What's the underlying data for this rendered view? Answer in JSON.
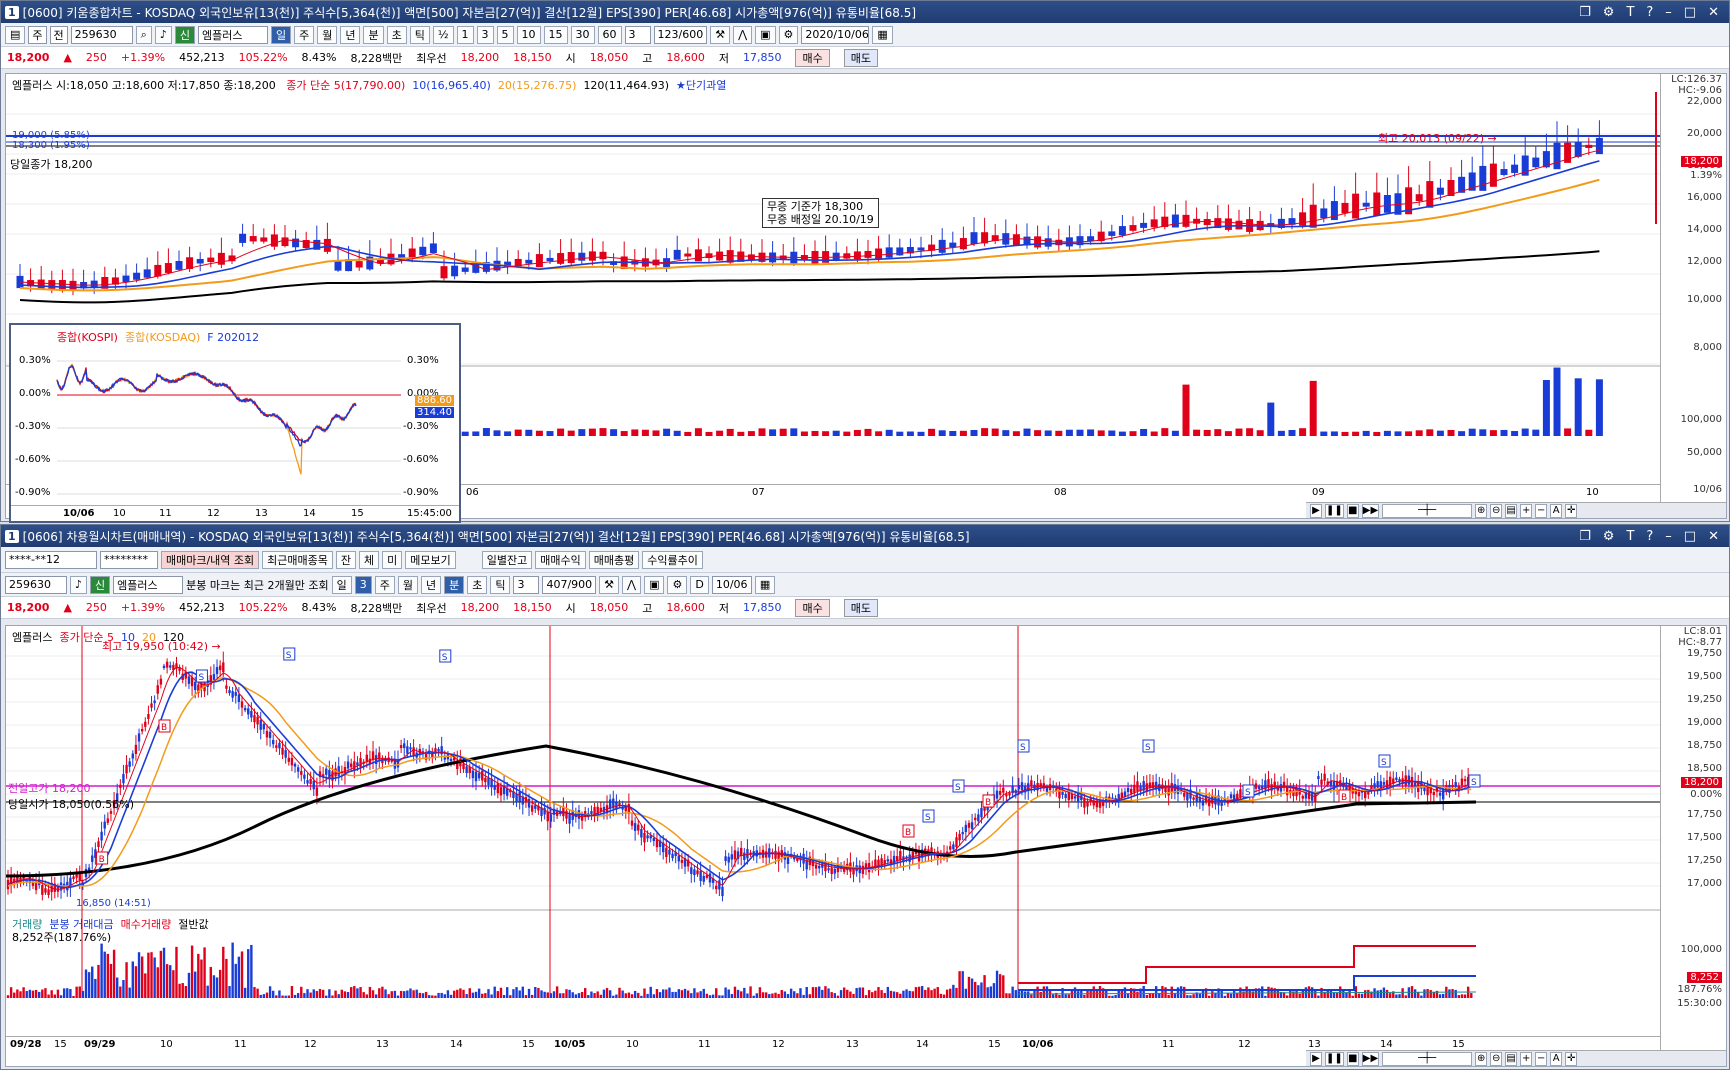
{
  "top": {
    "title": "[0600] 키움종합차트 - KOSDAQ 외국인보유[13(천)] 주식수[5,364(천)] 액면[500] 자본금[27(억)] 결산[12월] EPS[390] PER[46.68] 시가총액[976(억)] 유통비율[68.5]",
    "num": "1",
    "toolbar": {
      "type": "주",
      "combo": "전",
      "code": "259630",
      "tabs": [
        "일",
        "주",
        "월",
        "년",
        "분",
        "초",
        "틱"
      ],
      "active_tab": "일",
      "ints": [
        "½",
        "1",
        "3",
        "5",
        "10",
        "15",
        "30",
        "60"
      ],
      "count": "3",
      "ratio": "123/600",
      "date": "2020/10/06",
      "emplus": "엠플러스",
      "shin": "신"
    },
    "quote": {
      "price": "18,200",
      "arrow": "▲",
      "change": "250",
      "pct": "+1.39%",
      "volume": "452,213",
      "vol_ratio": "105.22%",
      "turnover": "8.43%",
      "amount": "8,228백만",
      "best_label": "최우선",
      "ask": "18,200",
      "bid": "18,150",
      "open_label": "시",
      "open": "18,050",
      "high_label": "고",
      "high": "18,600",
      "low_label": "저",
      "low": "17,850",
      "buy": "매수",
      "sell": "매도"
    },
    "legend": {
      "ohlc": "엠플러스 시:18,050 고:18,600 저:17,850 종:18,200",
      "ma_label": "종가 단순 5(17,790.00)",
      "ma10": "10(16,965.40)",
      "ma20": "20(15,276.75)",
      "ma120": "120(11,464.93)",
      "signal": "★단기과열"
    },
    "yaxis": [
      "22,000",
      "20,000",
      "18,000",
      "16,000",
      "14,000",
      "12,000",
      "10,000",
      "8,000"
    ],
    "lc": "LC:126.37",
    "hc": "HC:-9.06",
    "price_tag": "18,200",
    "price_pct": "1.39%",
    "hl1": "19,000 (5.85%)",
    "hl2": "18,300 (1.95%)",
    "prev_close": "당일종가 18,200",
    "peak_label": "최고 20,013 (09/22) →",
    "dividend": [
      "무증 기준가 18,300",
      "무증 배정일 20.10/19"
    ],
    "vol_axis": [
      "100,000",
      "50,000"
    ],
    "xaxis": [
      "06",
      "07",
      "08",
      "09",
      "10"
    ],
    "x_right": "10/06",
    "inset": {
      "legend": [
        "종합(KOSPI)",
        "종합(KOSDAQ)",
        "F 202012"
      ],
      "left_ticks": [
        "0.30%",
        "0.00%",
        "-0.30%",
        "-0.60%",
        "-0.90%"
      ],
      "right_ticks": [
        "0.30%",
        "0.00%",
        "-0.30%",
        "-0.60%",
        "-0.90%"
      ],
      "tag1": "886.60",
      "tag2": "314.40",
      "x": [
        "10/06",
        "10",
        "11",
        "12",
        "13",
        "14",
        "15"
      ],
      "time": "15:45:00"
    }
  },
  "bottom": {
    "title": "[0606] 차용월시차트(매매내역) - KOSDAQ 외국인보유[13(천)] 주식수[5,364(천)] 액면[500] 자본금[27(억)] 결산[12월] EPS[390] PER[46.68] 시가총액[976(억)] 유통비율[68.5]",
    "num": "1",
    "row1": {
      "account": "****-**12",
      "pw": "********",
      "btns": [
        "매매마크/내역 조회",
        "최근매매종목",
        "잔",
        "체",
        "미",
        "메모보기",
        "일별잔고",
        "매매수익",
        "매매총평",
        "수익률추이"
      ]
    },
    "row2": {
      "code": "259630",
      "emplus": "엠플러스",
      "shin": "신",
      "note": "분봉 마크는 최근 2개월만 조회",
      "tabs": [
        "일",
        "3",
        "주",
        "월",
        "년",
        "분",
        "초",
        "틱"
      ],
      "count": "3",
      "ratio": "407/900",
      "d": "D",
      "date": "10/06"
    },
    "legend": {
      "name": "엠플러스",
      "ma": "종가 단순 5",
      "m10": "10",
      "m20": "20",
      "m120": "120"
    },
    "peak": "최고 19,950 (10:42) →",
    "yaxis": [
      "19,750",
      "19,500",
      "19,250",
      "19,000",
      "18,750",
      "18,500",
      "18,250",
      "18,000",
      "17,750",
      "17,500",
      "17,250",
      "17,000"
    ],
    "lc": "LC:8.01",
    "hc": "HC:-8.77",
    "price_tag": "18,200",
    "price_pct": "0.00%",
    "prev_close": "전일고가 18,200",
    "open_line": "당일시가 18,050(0.56%)",
    "low": "16,850 (14:51)",
    "vol_legend": [
      "거래량",
      "분봉 거래대금",
      "매수거래량",
      "절반값"
    ],
    "vol_info": "8,252주(187.76%)",
    "vol_axis": "100,000",
    "vol_tag": "8,252",
    "vol_tag2": "187.76%",
    "xaxis": [
      "09/28",
      "15",
      "09/29",
      "10",
      "11",
      "12",
      "13",
      "14",
      "15",
      "10/05",
      "10",
      "11",
      "12",
      "13",
      "14",
      "15",
      "10/06",
      "11",
      "12",
      "13",
      "14",
      "15"
    ],
    "time": "15:30:00"
  },
  "colors": {
    "up": "#e0001a",
    "down": "#1a3cd6",
    "ma5": "#e0001a",
    "ma10": "#1a3cd6",
    "ma20": "#f29b1a",
    "ma120": "#000000"
  }
}
